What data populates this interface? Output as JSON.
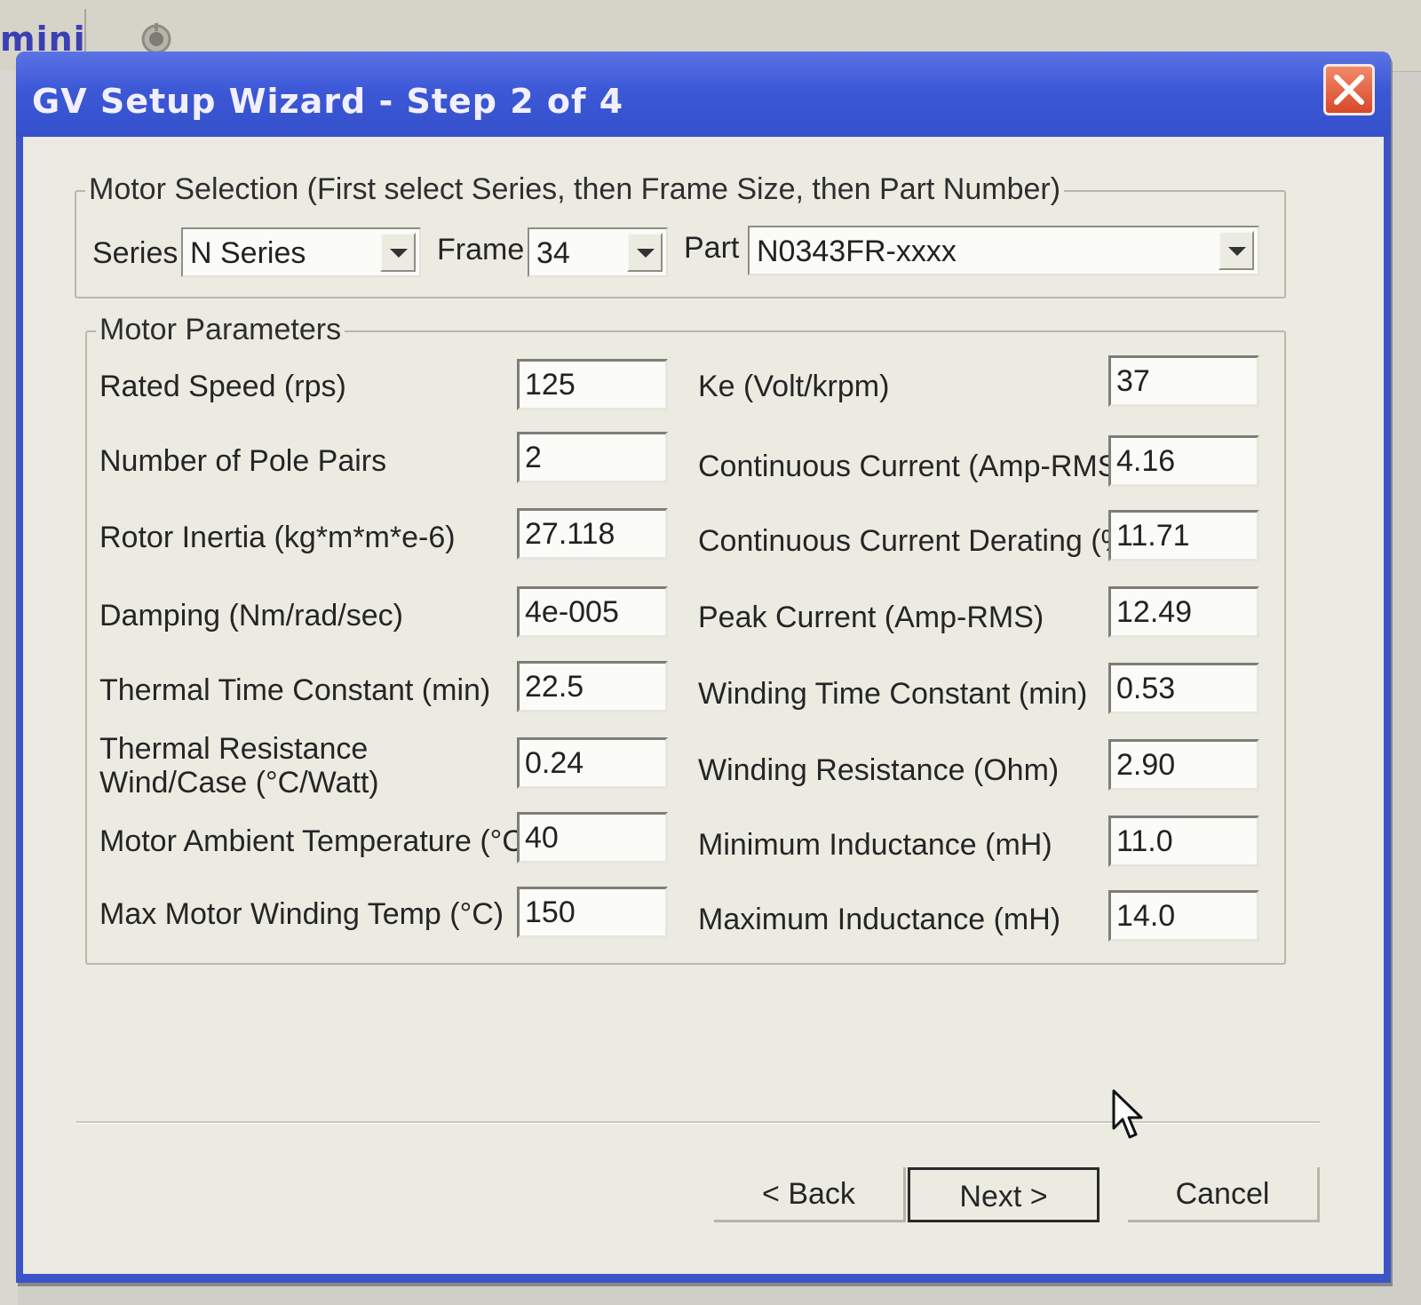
{
  "background_app": {
    "title": "mini"
  },
  "window": {
    "title": "GV Setup Wizard - Step 2 of 4"
  },
  "motor_selection": {
    "group_label": "Motor Selection (First select Series, then Frame Size, then Part Number)",
    "series_label": "Series",
    "series_value": "N Series",
    "frame_label": "Frame",
    "frame_value": "34",
    "part_label": "Part",
    "part_value": "N0343FR-xxxx"
  },
  "motor_parameters": {
    "group_label": "Motor Parameters",
    "left": [
      {
        "label": "Rated Speed (rps)",
        "value": "125"
      },
      {
        "label": "Number of Pole Pairs",
        "value": "2"
      },
      {
        "label": "Rotor Inertia (kg*m*m*e-6)",
        "value": "27.118"
      },
      {
        "label": "Damping (Nm/rad/sec)",
        "value": "4e-005"
      },
      {
        "label": "Thermal Time Constant (min)",
        "value": "22.5"
      },
      {
        "label": "Thermal Resistance Wind/Case (°C/Watt)",
        "value": "0.24"
      },
      {
        "label": "Motor Ambient Temperature (°C)",
        "value": "40"
      },
      {
        "label": "Max Motor Winding Temp (°C)",
        "value": "150"
      }
    ],
    "right": [
      {
        "label": "Ke (Volt/krpm)",
        "value": "37"
      },
      {
        "label": "Continuous Current (Amp-RMS)",
        "value": "4.16"
      },
      {
        "label": "Continuous Current Derating (%)",
        "value": "11.71"
      },
      {
        "label": "Peak Current (Amp-RMS)",
        "value": "12.49"
      },
      {
        "label": "Winding Time Constant (min)",
        "value": "0.53"
      },
      {
        "label": "Winding Resistance (Ohm)",
        "value": "2.90"
      },
      {
        "label": "Minimum Inductance (mH)",
        "value": "11.0"
      },
      {
        "label": "Maximum Inductance (mH)",
        "value": "14.0"
      }
    ]
  },
  "buttons": {
    "back": "< Back",
    "next": "Next >",
    "cancel": "Cancel"
  },
  "icons": {
    "close": "close-icon",
    "dropdown": "chevron-down-icon",
    "app": "app-icon",
    "cursor": "mouse-pointer-icon"
  },
  "colors": {
    "titlebar": "#3c54c8",
    "close_button": "#d8482a",
    "dialog_background": "#ecebe2"
  }
}
